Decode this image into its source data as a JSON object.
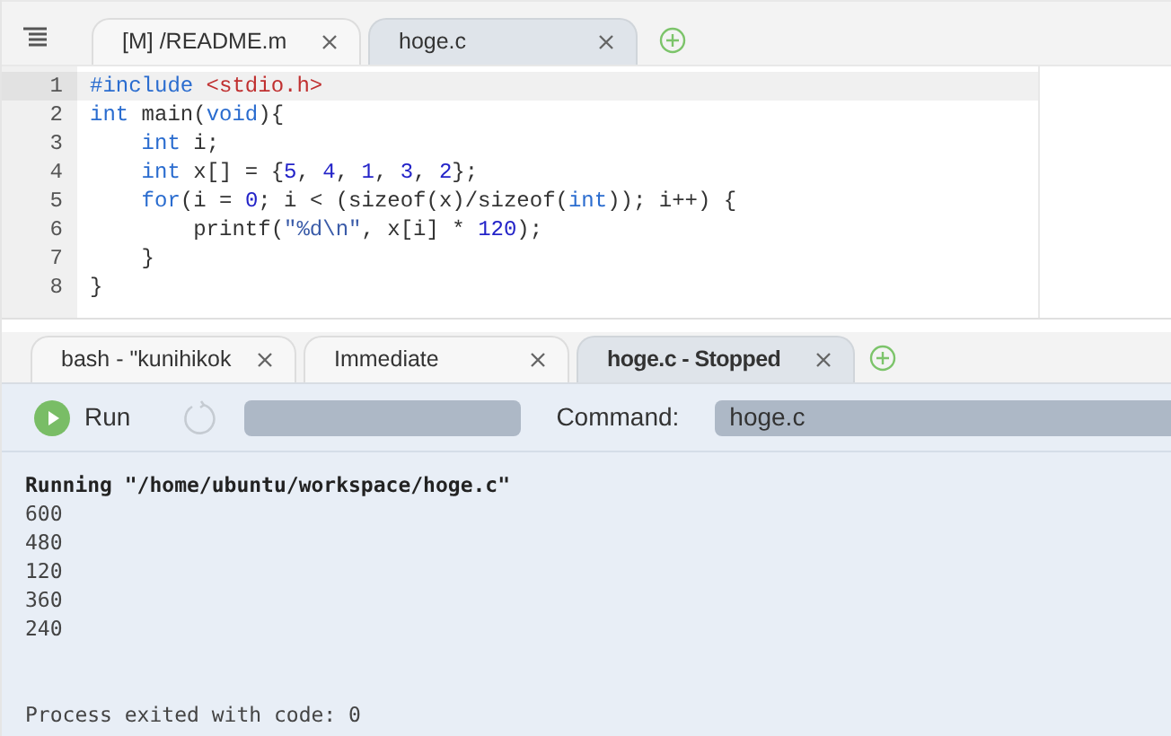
{
  "editor_tabs": [
    {
      "label": "[M] /README.m",
      "selected": false
    },
    {
      "label": "hoge.c",
      "selected": true
    }
  ],
  "code": [
    {
      "number": "1",
      "current": true,
      "tokens": [
        {
          "text": "#include",
          "kind": "keyword"
        },
        {
          "text": " <stdio.h>",
          "kind": "include"
        }
      ]
    },
    {
      "number": "2",
      "current": false,
      "tokens": [
        {
          "text": "int",
          "kind": "keyword"
        },
        {
          "text": " main(",
          "kind": "plain"
        },
        {
          "text": "void",
          "kind": "keyword"
        },
        {
          "text": "){",
          "kind": "plain"
        }
      ]
    },
    {
      "number": "3",
      "current": false,
      "tokens": [
        {
          "text": "    int",
          "kind": "keyword"
        },
        {
          "text": " i;",
          "kind": "plain"
        }
      ]
    },
    {
      "number": "4",
      "current": false,
      "tokens": [
        {
          "text": "    int",
          "kind": "keyword"
        },
        {
          "text": " x[] = {",
          "kind": "plain"
        },
        {
          "text": "5",
          "kind": "number"
        },
        {
          "text": ", ",
          "kind": "plain"
        },
        {
          "text": "4",
          "kind": "number"
        },
        {
          "text": ", ",
          "kind": "plain"
        },
        {
          "text": "1",
          "kind": "number"
        },
        {
          "text": ", ",
          "kind": "plain"
        },
        {
          "text": "3",
          "kind": "number"
        },
        {
          "text": ", ",
          "kind": "plain"
        },
        {
          "text": "2",
          "kind": "number"
        },
        {
          "text": "};",
          "kind": "plain"
        }
      ]
    },
    {
      "number": "5",
      "current": false,
      "tokens": [
        {
          "text": "    for",
          "kind": "keyword"
        },
        {
          "text": "(i = ",
          "kind": "plain"
        },
        {
          "text": "0",
          "kind": "number"
        },
        {
          "text": "; i < (sizeof(x)/sizeof(",
          "kind": "plain"
        },
        {
          "text": "int",
          "kind": "keyword"
        },
        {
          "text": ")); i++) {",
          "kind": "plain"
        }
      ]
    },
    {
      "number": "6",
      "current": false,
      "tokens": [
        {
          "text": "        printf(",
          "kind": "plain"
        },
        {
          "text": "\"%d\\n\"",
          "kind": "string"
        },
        {
          "text": ", x[i] * ",
          "kind": "plain"
        },
        {
          "text": "120",
          "kind": "number"
        },
        {
          "text": ");",
          "kind": "plain"
        }
      ]
    },
    {
      "number": "7",
      "current": false,
      "tokens": [
        {
          "text": "    }",
          "kind": "plain"
        }
      ]
    },
    {
      "number": "8",
      "current": false,
      "tokens": [
        {
          "text": "}",
          "kind": "plain"
        }
      ]
    }
  ],
  "console_tabs": [
    {
      "label": "bash - \"kunihikok",
      "selected": false
    },
    {
      "label": "Immediate",
      "selected": false
    },
    {
      "label": "hoge.c - Stopped",
      "selected": true
    }
  ],
  "run_bar": {
    "run_label": "Run",
    "command_label": "Command:",
    "command_value": "hoge.c"
  },
  "output": {
    "header": "Running \"/home/ubuntu/workspace/hoge.c\"",
    "lines": [
      "600",
      "480",
      "120",
      "360",
      "240"
    ],
    "exit_message": "Process exited with code: 0"
  }
}
